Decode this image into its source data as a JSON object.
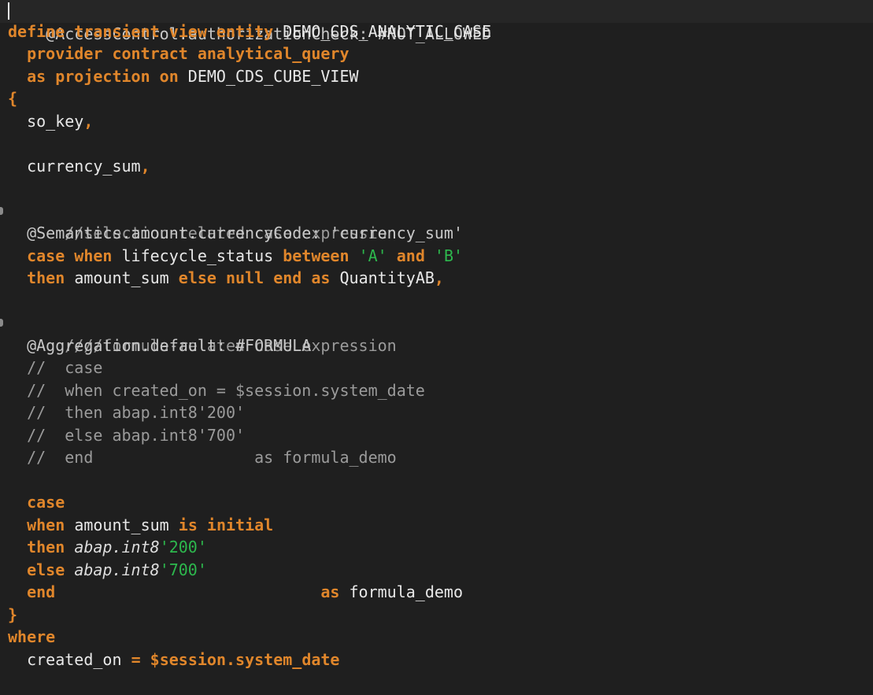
{
  "code": {
    "l1": "@AccessControl.authorizationCheck: #NOT_ALLOWED",
    "l2_kw": "define transient view entity",
    "l2_id": "DEMO_CDS_ANALYTIC_CASE",
    "l3_kw": "provider contract analytical_query",
    "l4_kw": "as projection on",
    "l4_id": "DEMO_CDS_CUBE_VIEW",
    "l5": "{",
    "l6": "so_key",
    "l6_p": ",",
    "l8": "currency_sum",
    "l8_p": ",",
    "l10": "//selection-related case expression",
    "l11": "@Semantics.amount.currencyCode: 'currency_sum'",
    "l12_case": "case when",
    "l12_id": "lifecycle_status",
    "l12_between": "between",
    "l12_a": "'A'",
    "l12_and": "and",
    "l12_b": "'B'",
    "l13_then": "then",
    "l13_amt": "amount_sum",
    "l13_else": "else null end as",
    "l13_id": "QuantityAB",
    "l13_p": ",",
    "l15": "////formula-related case expression",
    "l16": "@Aggregation.default: #FORMULA",
    "l17": "//  case",
    "l18": "//  when created_on = $session.system_date",
    "l19": "//  then abap.int8'200'",
    "l20": "//  else abap.int8'700'",
    "l21": "//  end                 as formula_demo",
    "l23_case": "case",
    "l24_when": "when",
    "l24_amt": "amount_sum",
    "l24_is": "is initial",
    "l25_then": "then",
    "l25_fn": "abap.int8",
    "l25_val": "'200'",
    "l26_else": "else",
    "l26_fn": "abap.int8",
    "l26_val": "'700'",
    "l27_end": "end",
    "l27_as": "as",
    "l27_id": "formula_demo",
    "l28": "}",
    "l29": "where",
    "l30_id": "created_on",
    "l30_eq": "=",
    "l30_sess": "$session.system_date"
  },
  "colors": {
    "background": "#1f1f1f",
    "keyword": "#e0862b",
    "string": "#2db84d",
    "comment": "#9b9b9b",
    "identifier": "#e8e8e8"
  },
  "icons": [
    "fold-marker-icon"
  ]
}
